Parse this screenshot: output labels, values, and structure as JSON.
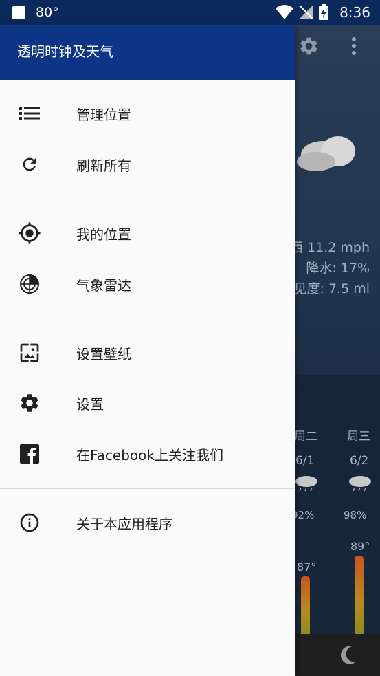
{
  "status_bar": {
    "temperature": "80°",
    "time": "8:36"
  },
  "drawer": {
    "title": "透明时钟及天气",
    "items": [
      {
        "label": "管理位置",
        "icon": "list-icon"
      },
      {
        "label": "刷新所有",
        "icon": "refresh-icon"
      },
      {
        "label": "我的位置",
        "icon": "my-location-icon"
      },
      {
        "label": "气象雷达",
        "icon": "radar-icon"
      },
      {
        "label": "设置壁纸",
        "icon": "wallpaper-icon"
      },
      {
        "label": "设置",
        "icon": "gear-icon"
      },
      {
        "label": "在Facebook上关注我们",
        "icon": "facebook-icon"
      },
      {
        "label": "关于本应用程序",
        "icon": "info-icon"
      }
    ]
  },
  "background": {
    "wind": "西 11.2 mph",
    "precip": "降水: 17%",
    "visibility": "见度: 7.5 mi",
    "forecast": [
      {
        "day": "周二",
        "date": "6/1",
        "humidity": "92%",
        "high": "87°"
      },
      {
        "day": "周三",
        "date": "6/2",
        "humidity": "98%",
        "high": "89°"
      }
    ]
  },
  "colors": {
    "header": "#0d3586",
    "status_bar": "#0b2a5c",
    "drawer_bg": "#fafafa"
  }
}
